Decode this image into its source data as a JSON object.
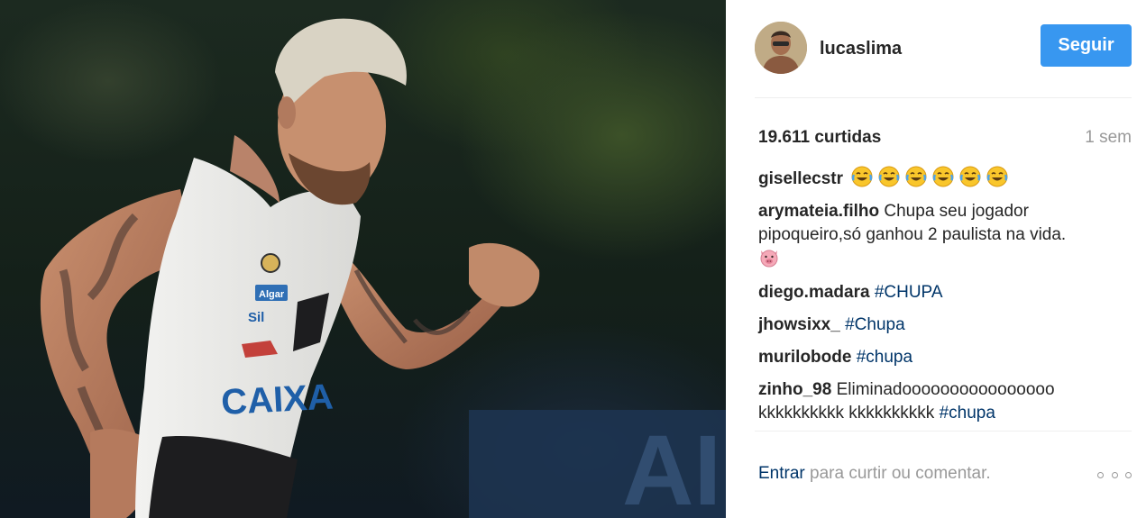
{
  "post": {
    "photo_alt": "",
    "photo_text": {
      "jersey_brand": "CAIXA",
      "jersey_sponsor": "Algar",
      "jersey_sponsor2": "Sil"
    }
  },
  "header": {
    "username": "lucaslima",
    "follow_label": "Seguir"
  },
  "meta": {
    "likes": "19.611 curtidas",
    "time_ago": "1 sem"
  },
  "comments": [
    {
      "user": "gisellecstr",
      "text": "",
      "emoji": [
        "laugh-cry-emoji",
        "laugh-cry-emoji",
        "laugh-cry-emoji",
        "laugh-cry-emoji",
        "laugh-cry-emoji",
        "laugh-cry-emoji"
      ]
    },
    {
      "user": "arymateia.filho",
      "text": "Chupa seu jogador pipoqueiro,só ganhou 2 paulista na vida.",
      "emoji": [
        "pig-face-emoji"
      ]
    },
    {
      "user": "diego.madara",
      "text": "",
      "hashtag": "#CHUPA"
    },
    {
      "user": "jhowsixx_",
      "text": "",
      "hashtag": "#Chupa"
    },
    {
      "user": "murilobode",
      "text": "",
      "hashtag": "#chupa"
    },
    {
      "user": "zinho_98",
      "text": "Eliminadoooooooooooooooo kkkkkkkkkk kkkkkkkkkk",
      "hashtag": "#chupa"
    }
  ],
  "footer": {
    "login_label": "Entrar",
    "login_text": "para curtir ou comentar."
  },
  "colors": {
    "accent": "#3897f0",
    "link": "#003569",
    "muted": "#999999"
  },
  "icons": {
    "more": "more-options-icon"
  }
}
